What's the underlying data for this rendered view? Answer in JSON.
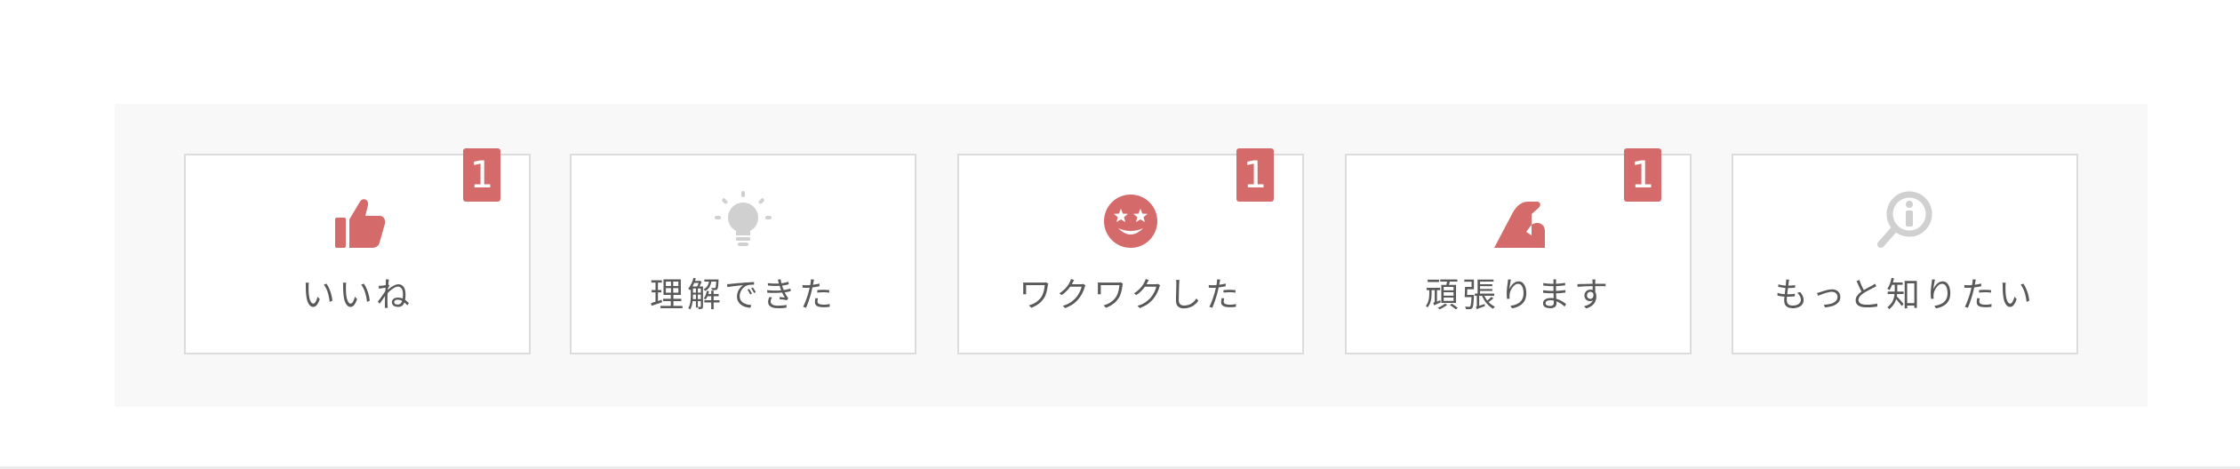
{
  "colors": {
    "accent": "#d46a6a",
    "inactive_icon": "#d0d0d0",
    "label_text": "#595959",
    "panel_bg": "#f8f8f8",
    "card_border": "#dcdcdc"
  },
  "reactions": [
    {
      "label": "いいね",
      "icon": "thumbs-up-icon",
      "count": "1",
      "active": true
    },
    {
      "label": "理解できた",
      "icon": "lightbulb-icon",
      "count": "",
      "active": false
    },
    {
      "label": "ワクワクした",
      "icon": "star-eyes-face-icon",
      "count": "1",
      "active": true
    },
    {
      "label": "頑張ります",
      "icon": "flexed-arm-icon",
      "count": "1",
      "active": true
    },
    {
      "label": "もっと知りたい",
      "icon": "magnifier-info-icon",
      "count": "",
      "active": false
    }
  ]
}
